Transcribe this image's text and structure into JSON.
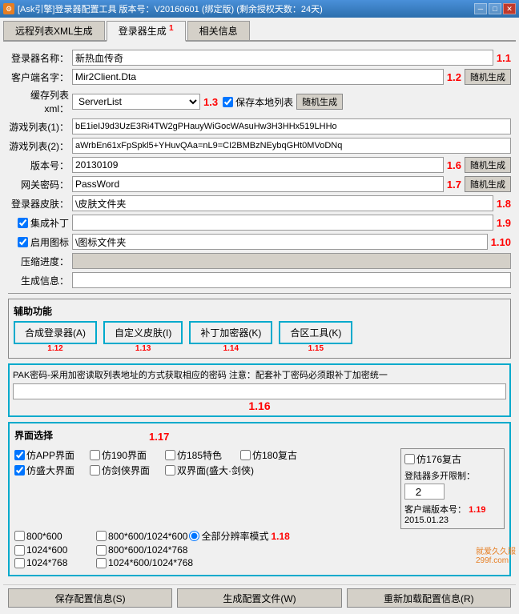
{
  "titleBar": {
    "icon": "⚙",
    "title": "[Ask引擎]登录器配置工具  版本号：V20160601 (绑定版) (剩余授权天数：24天)",
    "minimizeLabel": "─",
    "maximizeLabel": "□",
    "closeLabel": "✕"
  },
  "tabs": [
    {
      "id": "remote-list",
      "label": "远程列表XML生成",
      "active": false,
      "number": ""
    },
    {
      "id": "login-gen",
      "label": "登录器生成",
      "active": true,
      "number": "1"
    },
    {
      "id": "info",
      "label": "相关信息",
      "active": false,
      "number": ""
    }
  ],
  "form": {
    "loginNameLabel": "登录器名称：",
    "loginNameValue": "新热血传奇",
    "loginNameNum": "1.1",
    "clientFileLabel": "客户端名字：",
    "clientFileValue": "Mir2Client.Dta",
    "clientFileNum": "1.2",
    "generateRandom": "随机生成",
    "serverListLabel": "缓存列表xml：",
    "serverListValue": "ServerList",
    "serverListNum": "1.3",
    "saveLocalLabel": "保存本地列表",
    "saveLocalChecked": true,
    "serverList1Label": "游戏列表(1)：",
    "serverList1Value": "bE1ieIJ9d3UzE3Ri4TW2gPHauyWiGocWAsuHw3H3HHx519LHHo",
    "serverList2Label": "游戏列表(2)：",
    "serverList2Value": "aWrbEn61xFpSpkl5+YHuvQAa=nL9=CI2BMBzNEybqGHt0MVoDNq",
    "versionLabel": "版本号：",
    "versionValue": "20130109",
    "versionNum": "1.6",
    "gatewayPwdLabel": "网关密码：",
    "gatewayPwdValue": "PassWord",
    "gatewayPwdNum": "1.7",
    "loginSkinLabel": "登录器皮肤：",
    "loginSkinValue": "\\皮肤文件夹",
    "loginSkinNum": "1.8",
    "integratePatchLabel": "集成补丁",
    "integratePatchValue": "",
    "integratePatchNum": "1.9",
    "integratePatchChecked": true,
    "enableIconLabel": "启用图标",
    "enableIconValue": "\\图标文件夹",
    "enableIconNum": "1.10",
    "enableIconChecked": true,
    "compressLabel": "压缩进度：",
    "genInfoLabel": "生成信息："
  },
  "auxSection": {
    "title": "辅助功能",
    "mergeLoginLabel": "合成登录器(A)",
    "mergeLoginNum": "1.12",
    "customSkinLabel": "自定义皮肤(I)",
    "customSkinNum": "1.13",
    "patchEncryptLabel": "补丁加密器(K)",
    "patchEncryptNum": "1.14",
    "mergeToolLabel": "合区工具(K)",
    "mergeToolNum": "1.15"
  },
  "pakSection": {
    "title": "PAK密码-采用加密读取列表地址的方式获取相应的密码 注意：配套补丁密码必须跟补丁加密统一",
    "inputValue": "",
    "num": "1.16"
  },
  "interfaceSection": {
    "title": "界面选择",
    "titleNum": "1.17",
    "items": [
      {
        "label": "仿APP界面",
        "checked": true
      },
      {
        "label": "仿190界面",
        "checked": false
      },
      {
        "label": "仿185特色",
        "checked": false
      },
      {
        "label": "仿180复古",
        "checked": false
      },
      {
        "label": "仿176复古",
        "checked": false
      }
    ],
    "items2": [
      {
        "label": "仿盛大界面",
        "checked": true
      },
      {
        "label": "仿剑侠界面",
        "checked": false
      },
      {
        "label": "双界面(盛大·剑侠)",
        "checked": false
      }
    ],
    "loginLimit": {
      "label": "登陆器多开限制：",
      "value": "2"
    },
    "resolutions": [
      {
        "label": "800*600",
        "checked": false
      },
      {
        "label": "800*600/1024*600",
        "checked": false
      },
      {
        "label": "全部分辨率模式",
        "checked": true
      }
    ],
    "resolutions2": [
      {
        "label": "1024*600",
        "checked": false
      },
      {
        "label": "800*600/1024*768",
        "checked": false
      }
    ],
    "resolutions3": [
      {
        "label": "1024*768",
        "checked": false
      },
      {
        "label": "1024*600/1024*768",
        "checked": false
      }
    ],
    "resNum": "1.18",
    "clientVersionLabel": "客户端版本号：",
    "clientVersionNum": "1.19",
    "clientVersionValue": "2015.01.23"
  },
  "bottomBar": {
    "saveConfigLabel": "保存配置信息(S)",
    "genConfigLabel": "生成配置文件(W)",
    "reloadConfigLabel": "重新加载配置信息(R)"
  },
  "watermark": "就爱久久服\n299f.com"
}
